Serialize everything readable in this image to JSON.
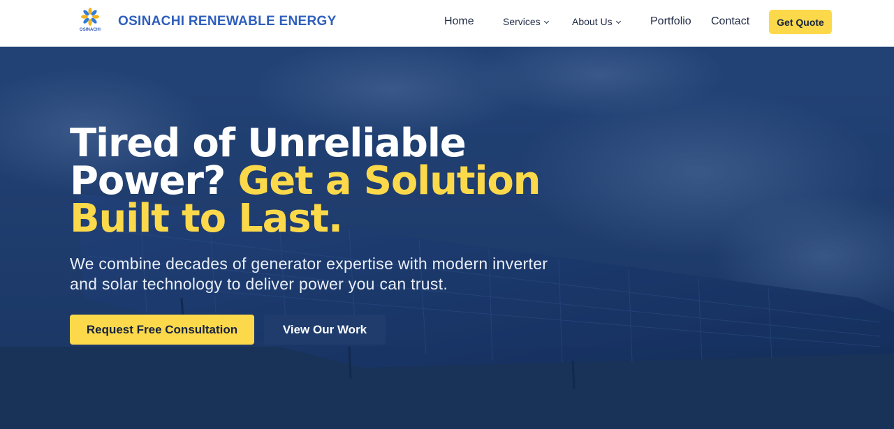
{
  "brand": {
    "name": "OSINACHI RENEWABLE ENERGY",
    "logo_text": "OSINACHI",
    "logo_icon": "sun-flower-icon"
  },
  "nav": {
    "home": "Home",
    "services": "Services",
    "about": "About Us",
    "portfolio": "Portfolio",
    "contact": "Contact",
    "cta": "Get Quote"
  },
  "hero": {
    "headline_white": "Tired of Unreliable Power?",
    "headline_yellow": "Get a Solution Built to Last.",
    "subtext": "We combine decades of generator expertise with modern inverter and solar technology to deliver power you can trust.",
    "primary_button": "Request Free Consultation",
    "secondary_button": "View Our Work"
  },
  "colors": {
    "accent_yellow": "#fcd94a",
    "brand_blue": "#2f5fbd",
    "hero_navy": "#274779",
    "text_dark": "#1f2a44"
  }
}
